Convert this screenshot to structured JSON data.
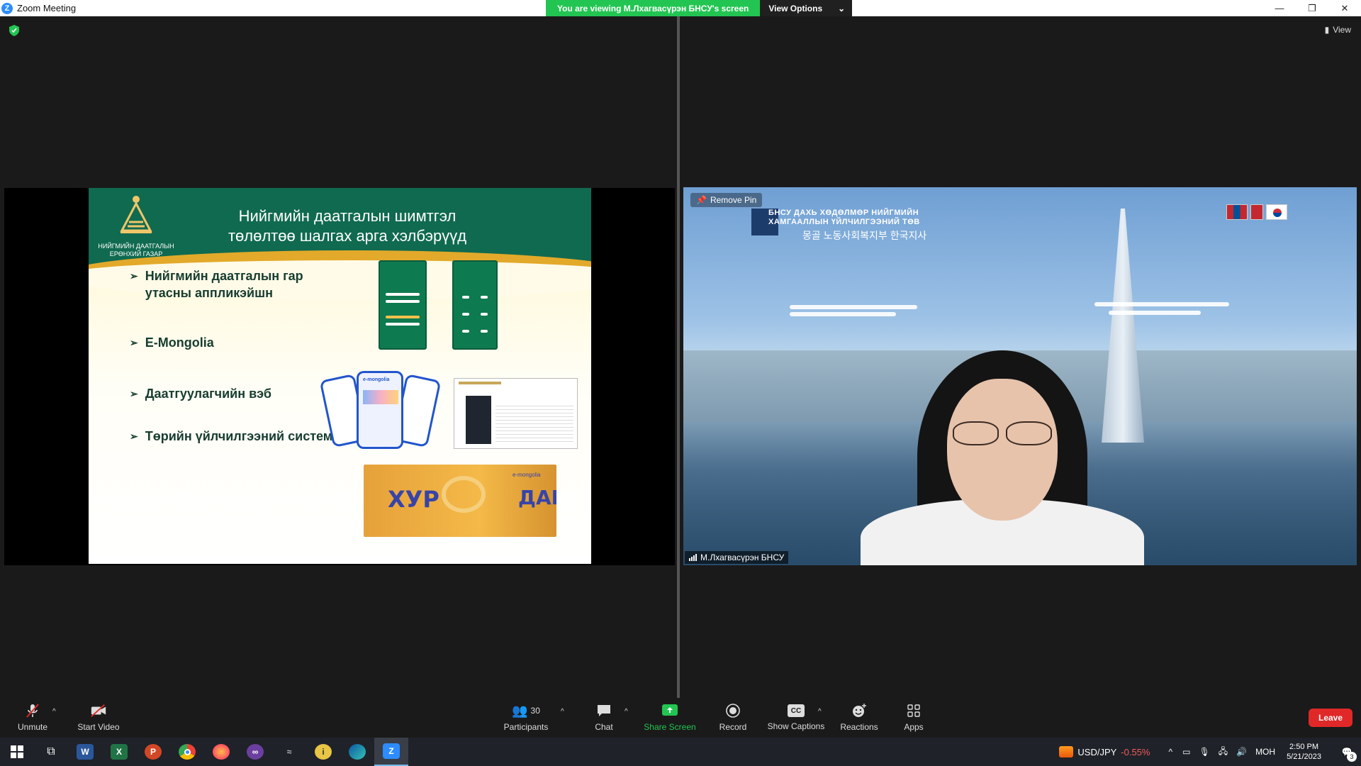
{
  "window": {
    "app_icon": "Z",
    "title": "Zoom Meeting",
    "viewing_banner": "You are viewing М.Лхагвасүрэн БНСУ's screen",
    "view_options": "View Options",
    "controls": [
      "minimize-icon",
      "restore-icon",
      "close-icon"
    ]
  },
  "top_right": {
    "view_label": "View"
  },
  "slide": {
    "title_line1": "Нийгмийн даатгалын шимтгэл",
    "title_line2": "төлөлтөө шалгах арга хэлбэрүүд",
    "logo_line1": "НИЙГМИЙН ДААТГАЛЫН",
    "logo_line2": "ЕРӨНХИЙ ГАЗАР",
    "bullets": [
      "Нийгмийн даатгалын гар утасны аппликэйшн",
      "E-Mongolia",
      "Даатгуулагчийн вэб",
      "Төрийн үйлчилгээний систем"
    ],
    "khur_left": "ХУР",
    "khur_right": "ДАН",
    "khur_brand": "e-mongolia"
  },
  "video": {
    "remove_pin": "Remove Pin",
    "participant_name": "М.Лхагвасүрэн БНСУ",
    "banner_line1": "БНСУ ДАХЬ ХӨДӨЛМӨР НИЙГМИЙН",
    "banner_line2": "ХАМГААЛЛЫН ҮЙЛЧИЛГЭЭНИЙ ТӨВ",
    "banner_korean": "몽골 노동사회복지부 한국지사"
  },
  "toolbar": {
    "unmute": "Unmute",
    "start_video": "Start Video",
    "participants": "Participants",
    "participants_count": "30",
    "chat": "Chat",
    "share_screen": "Share Screen",
    "record": "Record",
    "show_captions": "Show Captions",
    "captions_icon": "CC",
    "reactions": "Reactions",
    "apps": "Apps",
    "leave": "Leave"
  },
  "taskbar": {
    "apps": [
      "windows-start",
      "task-view",
      "word",
      "excel",
      "powerpoint",
      "chrome",
      "firefox",
      "app-mask",
      "app-fish",
      "app-idea",
      "edge",
      "zoom"
    ],
    "ticker_pair": "USD/JPY",
    "ticker_change": "-0.55%",
    "language": "МОН",
    "time": "2:50 PM",
    "date": "5/21/2023",
    "notifications": "3"
  },
  "colors": {
    "zoom_blue": "#2d8cff",
    "share_green": "#23c552",
    "leave_red": "#e02828",
    "slide_green": "#106a4f",
    "slide_gold": "#e3a92a"
  }
}
